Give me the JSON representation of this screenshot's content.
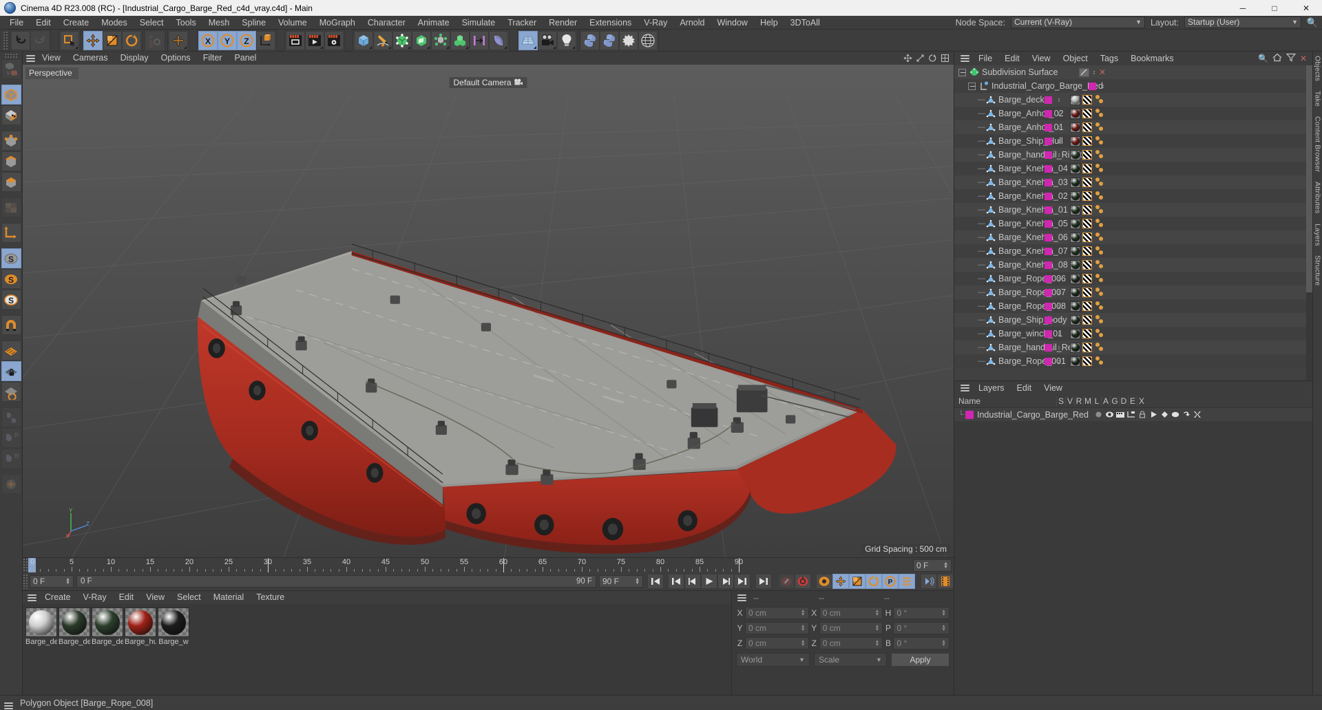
{
  "titlebar": {
    "title": "Cinema 4D R23.008 (RC) - [Industrial_Cargo_Barge_Red_c4d_vray.c4d] - Main",
    "minimize": "─",
    "maximize": "□",
    "close": "✕"
  },
  "menubar": {
    "items": [
      "File",
      "Edit",
      "Create",
      "Modes",
      "Select",
      "Tools",
      "Mesh",
      "Spline",
      "Volume",
      "MoGraph",
      "Character",
      "Animate",
      "Simulate",
      "Tracker",
      "Render",
      "Extensions",
      "V-Ray",
      "Arnold",
      "Window",
      "Help",
      "3DToAll"
    ],
    "node_space_label": "Node Space:",
    "node_space_value": "Current (V-Ray)",
    "layout_label": "Layout:",
    "layout_value": "Startup (User)"
  },
  "viewport": {
    "menu": [
      "View",
      "Cameras",
      "Display",
      "Options",
      "Filter",
      "Panel"
    ],
    "view_label": "Perspective",
    "camera_label": "Default Camera",
    "grid_spacing": "Grid Spacing : 500 cm",
    "axis": {
      "x": "X",
      "y": "Y",
      "z": "Z"
    }
  },
  "timeline": {
    "ticks": [
      {
        "v": "0",
        "f": 0
      },
      {
        "v": "5",
        "f": 5
      },
      {
        "v": "10",
        "f": 10
      },
      {
        "v": "15",
        "f": 15
      },
      {
        "v": "20",
        "f": 20
      },
      {
        "v": "25",
        "f": 25
      },
      {
        "v": "30",
        "f": 30
      },
      {
        "v": "35",
        "f": 35
      },
      {
        "v": "40",
        "f": 40
      },
      {
        "v": "45",
        "f": 45
      },
      {
        "v": "50",
        "f": 50
      },
      {
        "v": "55",
        "f": 55
      },
      {
        "v": "60",
        "f": 60
      },
      {
        "v": "65",
        "f": 65
      },
      {
        "v": "70",
        "f": 70
      },
      {
        "v": "75",
        "f": 75
      },
      {
        "v": "80",
        "f": 80
      },
      {
        "v": "85",
        "f": 85
      },
      {
        "v": "90",
        "f": 90
      }
    ],
    "current_frame_right": "0 F",
    "start_field": "0 F",
    "range_start": "0 F",
    "range_end": "90 F",
    "end_field": "90 F",
    "max_frame": 90
  },
  "materials": {
    "menu": [
      "Create",
      "V-Ray",
      "Edit",
      "View",
      "Select",
      "Material",
      "Texture"
    ],
    "items": [
      {
        "name": "Barge_de",
        "color": "#cfcfcf"
      },
      {
        "name": "Barge_de",
        "color": "#2b3a2b"
      },
      {
        "name": "Barge_de",
        "color": "#2d3f2d"
      },
      {
        "name": "Barge_hu",
        "color": "#9e2218"
      },
      {
        "name": "Barge_w",
        "color": "#1c1c1c"
      }
    ]
  },
  "coordinates": {
    "header": [
      "--",
      "--",
      "--"
    ],
    "rows": [
      {
        "l1": "X",
        "v1": "0 cm",
        "l2": "X",
        "v2": "0 cm",
        "l3": "H",
        "v3": "0 °"
      },
      {
        "l1": "Y",
        "v1": "0 cm",
        "l2": "Y",
        "v2": "0 cm",
        "l3": "P",
        "v3": "0 °"
      },
      {
        "l1": "Z",
        "v1": "0 cm",
        "l2": "Z",
        "v2": "0 cm",
        "l3": "B",
        "v3": "0 °"
      }
    ],
    "space_select": "World",
    "mode_select": "Scale",
    "apply_button": "Apply"
  },
  "object_manager": {
    "menu": [
      "File",
      "Edit",
      "View",
      "Object",
      "Tags",
      "Bookmarks"
    ],
    "items": [
      {
        "name": "Subdivision Surface",
        "depth": 0,
        "icon": "generator",
        "layer": "none",
        "tags": []
      },
      {
        "name": "Industrial_Cargo_Barge_Red",
        "depth": 1,
        "icon": "null",
        "layer": "#cf27b0",
        "tags": []
      },
      {
        "name": "Barge_deck",
        "depth": 2,
        "icon": "polygon",
        "layer": "#cf27b0",
        "tags": [
          "mat",
          "uvw",
          "phong"
        ],
        "mat": "#b5b5b5"
      },
      {
        "name": "Barge_Anhor_02",
        "depth": 2,
        "icon": "polygon",
        "layer": "#cf27b0",
        "tags": [
          "mat",
          "uvw",
          "phong"
        ],
        "mat": "#6b1b18"
      },
      {
        "name": "Barge_Anhor_01",
        "depth": 2,
        "icon": "polygon",
        "layer": "#cf27b0",
        "tags": [
          "mat",
          "uvw",
          "phong"
        ],
        "mat": "#6b1b18"
      },
      {
        "name": "Barge_Ship_Hull",
        "depth": 2,
        "icon": "polygon",
        "layer": "#cf27b0",
        "tags": [
          "mat",
          "uvw",
          "phong"
        ],
        "mat": "#6b1b18"
      },
      {
        "name": "Barge_handrail_Right",
        "depth": 2,
        "icon": "polygon",
        "layer": "#cf27b0",
        "tags": [
          "mat",
          "uvw",
          "phong"
        ],
        "mat": "#203020"
      },
      {
        "name": "Barge_Knehta_04",
        "depth": 2,
        "icon": "polygon",
        "layer": "#cf27b0",
        "tags": [
          "mat",
          "uvw",
          "phong"
        ],
        "mat": "#203020"
      },
      {
        "name": "Barge_Knehta_03",
        "depth": 2,
        "icon": "polygon",
        "layer": "#cf27b0",
        "tags": [
          "mat",
          "uvw",
          "phong"
        ],
        "mat": "#203020"
      },
      {
        "name": "Barge_Knehta_02",
        "depth": 2,
        "icon": "polygon",
        "layer": "#cf27b0",
        "tags": [
          "mat",
          "uvw",
          "phong"
        ],
        "mat": "#203020"
      },
      {
        "name": "Barge_Knehta_01",
        "depth": 2,
        "icon": "polygon",
        "layer": "#cf27b0",
        "tags": [
          "mat",
          "uvw",
          "phong"
        ],
        "mat": "#203020"
      },
      {
        "name": "Barge_Knehta_05",
        "depth": 2,
        "icon": "polygon",
        "layer": "#cf27b0",
        "tags": [
          "mat",
          "uvw",
          "phong"
        ],
        "mat": "#203020"
      },
      {
        "name": "Barge_Knehta_06",
        "depth": 2,
        "icon": "polygon",
        "layer": "#cf27b0",
        "tags": [
          "mat",
          "uvw",
          "phong"
        ],
        "mat": "#203020"
      },
      {
        "name": "Barge_Knehta_07",
        "depth": 2,
        "icon": "polygon",
        "layer": "#cf27b0",
        "tags": [
          "mat",
          "uvw",
          "phong"
        ],
        "mat": "#203020"
      },
      {
        "name": "Barge_Knehta_08",
        "depth": 2,
        "icon": "polygon",
        "layer": "#cf27b0",
        "tags": [
          "mat",
          "uvw",
          "phong"
        ],
        "mat": "#203020"
      },
      {
        "name": "Barge_Rope_006",
        "depth": 2,
        "icon": "polygon",
        "layer": "#cf27b0",
        "tags": [
          "mat",
          "uvw",
          "phong"
        ],
        "mat": "#1e2a1e"
      },
      {
        "name": "Barge_Rope_007",
        "depth": 2,
        "icon": "polygon",
        "layer": "#cf27b0",
        "tags": [
          "mat",
          "uvw",
          "phong"
        ],
        "mat": "#1e2a1e"
      },
      {
        "name": "Barge_Rope_008",
        "depth": 2,
        "icon": "polygon",
        "layer": "#cf27b0",
        "tags": [
          "mat",
          "uvw",
          "phong"
        ],
        "mat": "#1e2a1e"
      },
      {
        "name": "Barge_Ship_body",
        "depth": 2,
        "icon": "polygon",
        "layer": "#cf27b0",
        "tags": [
          "mat",
          "uvw",
          "phong"
        ],
        "mat": "#1e2a1e"
      },
      {
        "name": "Barge_winch_01",
        "depth": 2,
        "icon": "polygon",
        "layer": "#cf27b0",
        "tags": [
          "mat",
          "uvw",
          "phong"
        ],
        "mat": "#1e2a1e"
      },
      {
        "name": "Barge_handrail_Rear",
        "depth": 2,
        "icon": "polygon",
        "layer": "#cf27b0",
        "tags": [
          "mat",
          "uvw",
          "phong"
        ],
        "mat": "#1e2a1e"
      },
      {
        "name": "Barge_Rope_001",
        "depth": 2,
        "icon": "polygon",
        "layer": "#cf27b0",
        "tags": [
          "mat",
          "uvw",
          "phong"
        ],
        "mat": "#1e2a1e"
      }
    ]
  },
  "layers": {
    "menu": [
      "Layers",
      "Edit",
      "View"
    ],
    "columns": [
      "Name",
      "S",
      "V",
      "R",
      "M",
      "L",
      "A",
      "G",
      "D",
      "E",
      "X"
    ],
    "rows": [
      {
        "name": "Industrial_Cargo_Barge_Red",
        "color": "#cf27b0"
      }
    ]
  },
  "dock": {
    "tabs": [
      "Objects",
      "Take",
      "Content Browser",
      "Attributes",
      "Layers",
      "Structure"
    ]
  },
  "statusbar": {
    "text": "Polygon Object [Barge_Rope_008]"
  },
  "colors": {
    "accent_orange": "#e08c2a",
    "selected_blue": "#8ba7d0",
    "layer_magenta": "#cf27b0",
    "hull_red": "#a62a20",
    "panel_bg": "#3d3d3d"
  }
}
